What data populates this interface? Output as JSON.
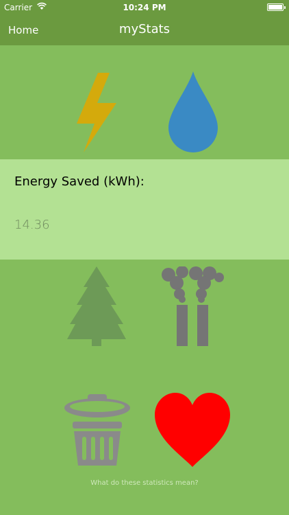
{
  "status_bar": {
    "carrier": "Carrier",
    "time": "10:24 PM",
    "wifi_icon": "wifi-icon",
    "battery_icon": "battery-icon"
  },
  "nav": {
    "back_label": "Home",
    "title": "myStats"
  },
  "icons": {
    "energy": "lightning-icon",
    "water": "water-drop-icon",
    "tree": "tree-icon",
    "emissions": "smokestack-icon",
    "waste": "trash-can-icon",
    "health": "heart-icon"
  },
  "stat": {
    "label": "Energy Saved (kWh):",
    "value": "14.36"
  },
  "footer": {
    "link_label": "What do these statistics mean?"
  },
  "colors": {
    "background": "#84bd5c",
    "bar": "#6b9a3f",
    "panel": "#b3e193",
    "lightning": "#d4aa0c",
    "water": "#3a8ac4",
    "tree": "#6d9a57",
    "factory": "#757575",
    "trash": "#8a8a8a",
    "heart": "#ff0000"
  }
}
